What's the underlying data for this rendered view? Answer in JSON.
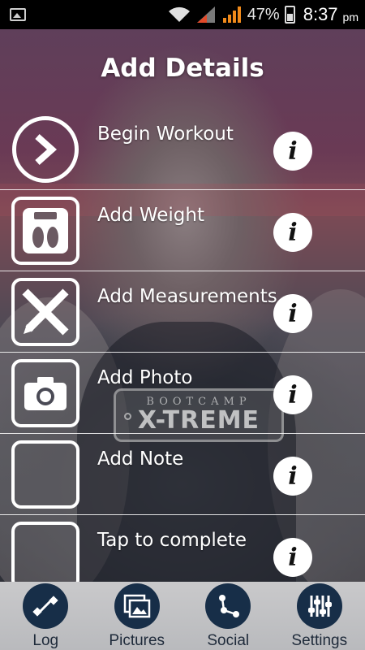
{
  "status_bar": {
    "battery_percent": "47%",
    "time": "8:37",
    "ampm": "pm"
  },
  "header": {
    "title": "Add Details"
  },
  "items": [
    {
      "label": "Begin Workout",
      "icon": "chevron-right-icon"
    },
    {
      "label": "Add Weight",
      "icon": "scale-icon"
    },
    {
      "label": "Add Measurements",
      "icon": "ruler-pencil-icon"
    },
    {
      "label": "Add Photo",
      "icon": "camera-icon"
    },
    {
      "label": "Add Note",
      "icon": "blank-box-icon"
    },
    {
      "label": "Tap to complete",
      "icon": "blank-box-icon"
    }
  ],
  "info_icon_glyph": "i",
  "watermark": {
    "line1": "BOOTCAMP",
    "line2": "X-TREME"
  },
  "tabs": [
    {
      "label": "Log",
      "icon": "dumbbell-icon"
    },
    {
      "label": "Pictures",
      "icon": "pictures-icon"
    },
    {
      "label": "Social",
      "icon": "share-nodes-icon"
    },
    {
      "label": "Settings",
      "icon": "sliders-icon"
    }
  ],
  "colors": {
    "tab_icon_bg": "#172e48",
    "tab_bar_bg": "#c3c3c6",
    "text": "#ffffff"
  }
}
